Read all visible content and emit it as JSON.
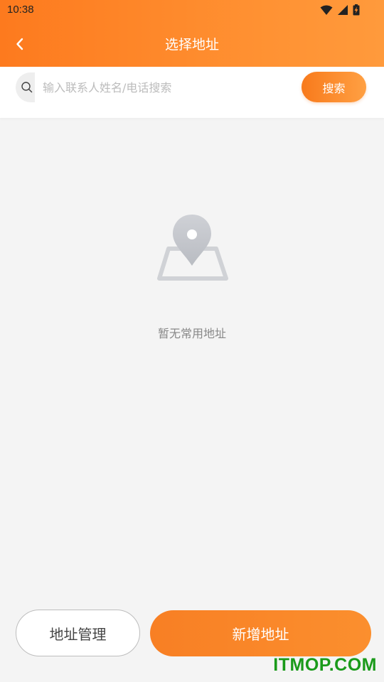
{
  "status_bar": {
    "time": "10:38",
    "icons": [
      "wifi-icon",
      "signal-icon",
      "battery-charging-icon"
    ]
  },
  "app_bar": {
    "back_icon": "chevron-left-icon",
    "title": "选择地址"
  },
  "search": {
    "icon": "search-icon",
    "placeholder": "输入联系人姓名/电话搜索",
    "value": "",
    "button_label": "搜索"
  },
  "empty_state": {
    "icon": "map-pin-icon",
    "text": "暂无常用地址"
  },
  "footer": {
    "manage_label": "地址管理",
    "add_label": "新增地址"
  },
  "watermark": "ITMOP.COM",
  "colors": {
    "accent": "#fd7a1e",
    "accent_light": "#ffa043",
    "background": "#f4f4f4",
    "watermark": "#1a9a1a"
  }
}
